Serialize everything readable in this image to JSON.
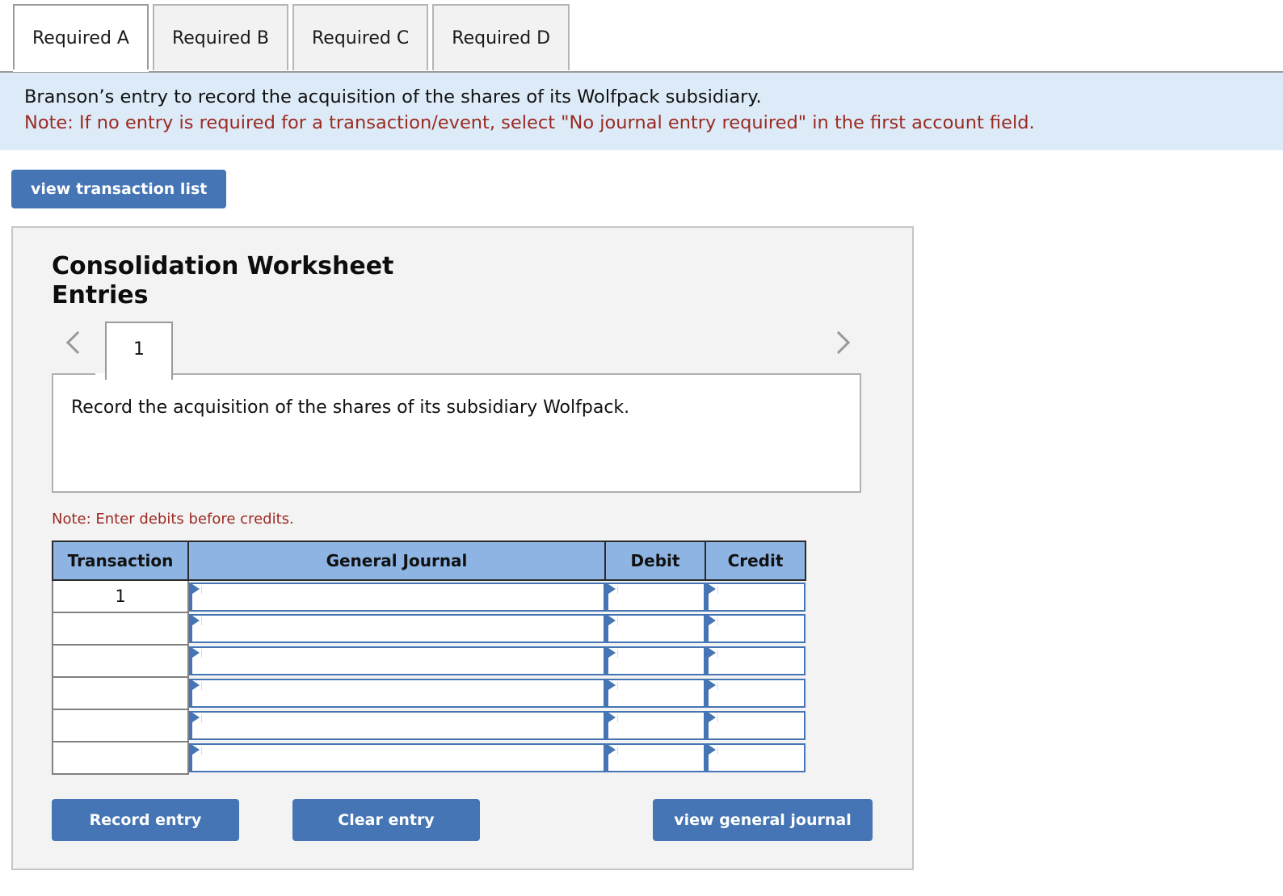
{
  "tabs": [
    {
      "label": "Required A",
      "active": true
    },
    {
      "label": "Required B",
      "active": false
    },
    {
      "label": "Required C",
      "active": false
    },
    {
      "label": "Required D",
      "active": false
    }
  ],
  "banner": {
    "prompt": "Branson’s entry to record the acquisition of the shares of its Wolfpack subsidiary.",
    "note": "Note: If no entry is required for a transaction/event, select \"No journal entry required\" in the first account field."
  },
  "toolbar": {
    "view_transaction_list": "view transaction list"
  },
  "worksheet": {
    "title": "Consolidation Worksheet Entries",
    "pager": {
      "prev_icon": "chevron-left-icon",
      "next_icon": "chevron-right-icon",
      "current_page": "1"
    },
    "description": "Record the acquisition of the shares of its subsidiary Wolfpack.",
    "debit_note": "Note: Enter debits before credits.",
    "table": {
      "headers": [
        "Transaction",
        "General Journal",
        "Debit",
        "Credit"
      ],
      "rows": [
        {
          "transaction": "1",
          "general_journal": "",
          "debit": "",
          "credit": ""
        },
        {
          "transaction": "",
          "general_journal": "",
          "debit": "",
          "credit": ""
        },
        {
          "transaction": "",
          "general_journal": "",
          "debit": "",
          "credit": ""
        },
        {
          "transaction": "",
          "general_journal": "",
          "debit": "",
          "credit": ""
        },
        {
          "transaction": "",
          "general_journal": "",
          "debit": "",
          "credit": ""
        },
        {
          "transaction": "",
          "general_journal": "",
          "debit": "",
          "credit": ""
        }
      ]
    },
    "buttons": {
      "record_entry": "Record entry",
      "clear_entry": "Clear entry",
      "view_general_journal": "view general journal"
    }
  },
  "colors": {
    "accent_blue": "#4575b4",
    "header_blue": "#8db4e2",
    "banner_blue": "#dcebf7",
    "note_red": "#9b2a22",
    "panel_gray": "#f3f3f3"
  }
}
